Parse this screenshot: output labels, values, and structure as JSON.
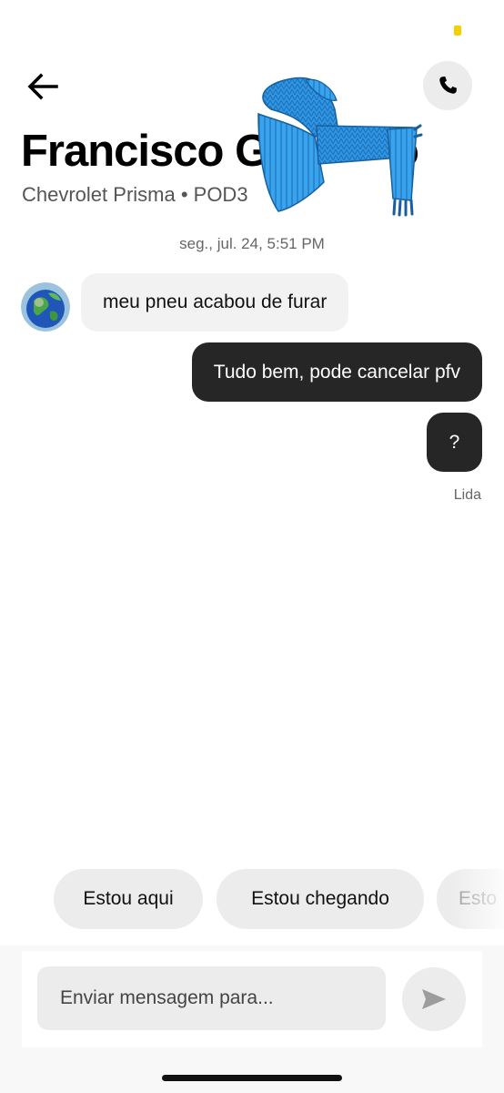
{
  "header": {
    "driver_name": "Francisco G",
    "name_tail": "o",
    "vehicle_info": "Chevrolet Prisma • POD3"
  },
  "icons": {
    "back": "arrow-left-icon",
    "call": "phone-icon",
    "send": "send-icon",
    "avatar": "globe-avatar",
    "sticker": "scarf-sticker"
  },
  "conversation": {
    "timestamp": "seg., jul. 24, 5:51 PM",
    "messages": [
      {
        "direction": "incoming",
        "text": "meu pneu acabou de furar"
      },
      {
        "direction": "outgoing",
        "text": "Tudo bem, pode cancelar pfv"
      },
      {
        "direction": "outgoing",
        "text": "?"
      }
    ],
    "read_receipt": "Lida"
  },
  "quick_replies": [
    "Estou aqui",
    "Estou chegando",
    "Esto"
  ],
  "composer": {
    "placeholder": "Enviar mensagem para..."
  },
  "colors": {
    "status_dot": "#f5d000",
    "outgoing_bubble": "#262626",
    "incoming_bubble": "#f2f2f2",
    "chip": "#ececec",
    "sticker": "#2f96e3"
  }
}
